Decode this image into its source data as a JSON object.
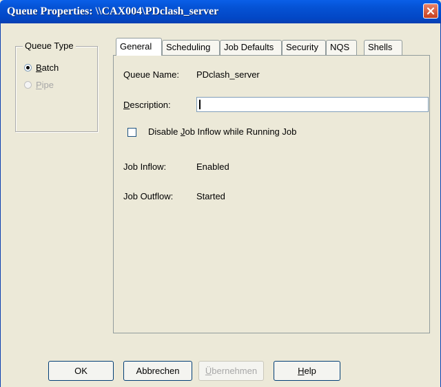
{
  "window": {
    "title": "Queue Properties: \\\\CAX004\\PDclash_server"
  },
  "queue_type": {
    "group_title": "Queue Type",
    "options": [
      {
        "label_underline": "B",
        "label_rest": "atch",
        "selected": true,
        "enabled": true
      },
      {
        "label_underline": "P",
        "label_rest": "ipe",
        "selected": false,
        "enabled": false
      }
    ]
  },
  "tabs": [
    {
      "label": "General",
      "active": true
    },
    {
      "label": "Scheduling",
      "active": false
    },
    {
      "label": "Job Defaults",
      "active": false
    },
    {
      "label": "Security",
      "active": false
    },
    {
      "label": "NQS",
      "active": false
    },
    {
      "label": "Shells",
      "active": false
    }
  ],
  "general": {
    "queue_name_label": "Queue Name:",
    "queue_name_value": "PDclash_server",
    "description_label_underline": "D",
    "description_label_rest": "escription:",
    "description_value": "",
    "disable_inflow_pre": "Disable ",
    "disable_inflow_underline": "J",
    "disable_inflow_rest": "ob Inflow while Running Job",
    "disable_inflow_checked": false,
    "job_inflow_label": "Job Inflow:",
    "job_inflow_value": "Enabled",
    "job_outflow_label": "Job Outflow:",
    "job_outflow_value": "Started"
  },
  "buttons": {
    "ok": "OK",
    "cancel": "Abbrechen",
    "apply_underline": "Ü",
    "apply_rest": "bernehmen",
    "help_underline": "H",
    "help_rest": "elp"
  },
  "colors": {
    "titlebar": "#0553d6",
    "dialog_bg": "#ece9d8",
    "close_button": "#c8401e"
  }
}
